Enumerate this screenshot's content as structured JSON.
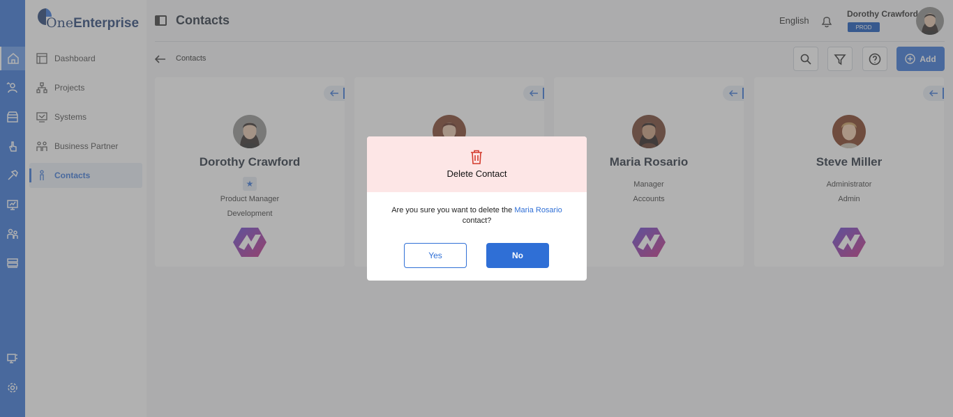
{
  "app": {
    "logo_prefix": "One",
    "logo_suffix": "Enterprise",
    "page_title": "Contacts",
    "language": "English"
  },
  "user": {
    "name": "Dorothy Crawford",
    "env": "PROD"
  },
  "rail": {
    "icons": [
      "home-icon",
      "users-switch-icon",
      "store-icon",
      "hand-touch-icon",
      "hammer-icon",
      "monitor-chart-icon",
      "people-icon",
      "server-stack-icon",
      "monitor-network-icon",
      "gear-icon"
    ]
  },
  "sidebar": {
    "items": [
      {
        "label": "Dashboard",
        "icon": "dashboard-icon"
      },
      {
        "label": "Projects",
        "icon": "hierarchy-icon"
      },
      {
        "label": "Systems",
        "icon": "systems-icon"
      },
      {
        "label": "Business Partner",
        "icon": "partners-icon"
      },
      {
        "label": "Contacts",
        "icon": "contact-person-icon"
      }
    ]
  },
  "breadcrumb": {
    "label": "Contacts"
  },
  "toolbar": {
    "add_label": "Add"
  },
  "cards": [
    {
      "name": "Dorothy Crawford",
      "line1": "Product Manager",
      "line2": "Development",
      "favorite": true
    },
    {
      "name": "",
      "line1": "",
      "line2": "",
      "favorite": false
    },
    {
      "name": "Maria Rosario",
      "line1": "Manager",
      "line2": "Accounts",
      "favorite": false
    },
    {
      "name": "Steve Miller",
      "line1": "Administrator",
      "line2": "Admin",
      "favorite": false
    }
  ],
  "modal": {
    "title": "Delete Contact",
    "message_before": "Are you sure you want to delete the ",
    "message_highlight": "Maria Rosario",
    "message_after": " contact?",
    "yes_label": "Yes",
    "no_label": "No"
  },
  "colors": {
    "accent": "#2f6fd6",
    "danger": "#d33a2c",
    "modal_header_bg": "#fde6e6",
    "env_badge": "#0b4fb8"
  }
}
